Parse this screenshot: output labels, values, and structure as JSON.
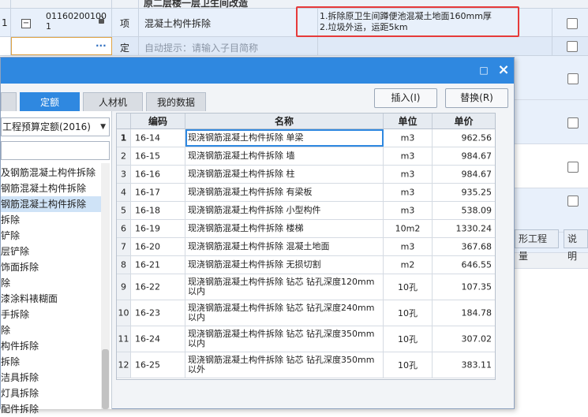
{
  "background": {
    "group_title": "原二层楼一层卫生间改造",
    "row": {
      "index": "1",
      "code": "01160200100 1",
      "type": "项",
      "name": "混凝土构件拆除",
      "description_lines": [
        "1.拆除原卫生间蹲便池混凝土地面160mm厚",
        "2.垃圾外运，运距5km"
      ]
    },
    "sub_row": {
      "type": "定",
      "hint": "自动提示：请输入子目简称",
      "ellipsis": "···"
    },
    "right_tabs": [
      "形工程量",
      "说明"
    ]
  },
  "dialog": {
    "close_icon": "×",
    "restore_icon": "□",
    "tabs": [
      {
        "label": "",
        "active": false
      },
      {
        "label": "定额",
        "active": true
      },
      {
        "label": "人材机",
        "active": false
      },
      {
        "label": "我的数据",
        "active": false
      }
    ],
    "buttons": {
      "insert": "插入(I)",
      "replace": "替换(R)"
    },
    "library_select": "工程预算定额(2016)",
    "search_placeholder": "",
    "tree_items": [
      {
        "label": "及钢筋混凝土构件拆除",
        "selected": false
      },
      {
        "label": "钢筋混凝土构件拆除",
        "selected": false
      },
      {
        "label": "钢筋混凝土构件拆除",
        "selected": true
      },
      {
        "label": "拆除",
        "selected": false
      },
      {
        "label": "铲除",
        "selected": false
      },
      {
        "label": "层铲除",
        "selected": false
      },
      {
        "label": "饰面拆除",
        "selected": false
      },
      {
        "label": "除",
        "selected": false
      },
      {
        "label": "漆涂料裱糊面",
        "selected": false
      },
      {
        "label": "手拆除",
        "selected": false
      },
      {
        "label": "除",
        "selected": false
      },
      {
        "label": "构件拆除",
        "selected": false
      },
      {
        "label": "拆除",
        "selected": false
      },
      {
        "label": "洁具拆除",
        "selected": false
      },
      {
        "label": "灯具拆除",
        "selected": false
      },
      {
        "label": "配件拆除",
        "selected": false
      }
    ],
    "table": {
      "headers": {
        "index": "",
        "code": "编码",
        "name": "名称",
        "unit": "单位",
        "price": "单价"
      },
      "rows": [
        {
          "index": "1",
          "code": "16-14",
          "name": "现浇钢筋混凝土构件拆除 单梁",
          "unit": "m3",
          "price": "962.56"
        },
        {
          "index": "2",
          "code": "16-15",
          "name": "现浇钢筋混凝土构件拆除 墙",
          "unit": "m3",
          "price": "984.67"
        },
        {
          "index": "3",
          "code": "16-16",
          "name": "现浇钢筋混凝土构件拆除 柱",
          "unit": "m3",
          "price": "984.67"
        },
        {
          "index": "4",
          "code": "16-17",
          "name": "现浇钢筋混凝土构件拆除 有梁板",
          "unit": "m3",
          "price": "935.25"
        },
        {
          "index": "5",
          "code": "16-18",
          "name": "现浇钢筋混凝土构件拆除 小型构件",
          "unit": "m3",
          "price": "538.09"
        },
        {
          "index": "6",
          "code": "16-19",
          "name": "现浇钢筋混凝土构件拆除 楼梯",
          "unit": "10m2",
          "price": "1330.24"
        },
        {
          "index": "7",
          "code": "16-20",
          "name": "现浇钢筋混凝土构件拆除 混凝土地面",
          "unit": "m3",
          "price": "367.68"
        },
        {
          "index": "8",
          "code": "16-21",
          "name": "现浇钢筋混凝土构件拆除 无损切割",
          "unit": "m2",
          "price": "646.55"
        },
        {
          "index": "9",
          "code": "16-22",
          "name": "现浇钢筋混凝土构件拆除 钻芯 钻孔深度120mm以内",
          "unit": "10孔",
          "price": "107.35"
        },
        {
          "index": "10",
          "code": "16-23",
          "name": "现浇钢筋混凝土构件拆除 钻芯 钻孔深度240mm以内",
          "unit": "10孔",
          "price": "184.78"
        },
        {
          "index": "11",
          "code": "16-24",
          "name": "现浇钢筋混凝土构件拆除 钻芯 钻孔深度350mm以内",
          "unit": "10孔",
          "price": "307.02"
        },
        {
          "index": "12",
          "code": "16-25",
          "name": "现浇钢筋混凝土构件拆除 钻芯 钻孔深度350mm以外",
          "unit": "10孔",
          "price": "383.11"
        }
      ]
    }
  },
  "colors": {
    "accent": "#2f88e0",
    "highlight_box": "#e63a3a",
    "row_blue": "#e8f0fb"
  }
}
